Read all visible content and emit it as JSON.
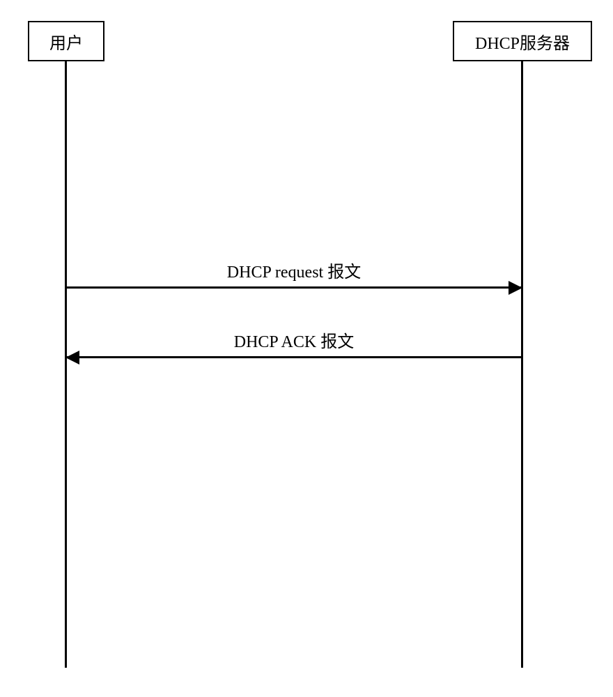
{
  "participants": {
    "left": "用户",
    "right": "DHCP服务器"
  },
  "messages": [
    {
      "label": "DHCP request 报文",
      "direction": "right"
    },
    {
      "label": "DHCP ACK 报文",
      "direction": "left"
    }
  ],
  "chart_data": {
    "type": "sequence-diagram",
    "participants": [
      "用户",
      "DHCP服务器"
    ],
    "messages": [
      {
        "from": "用户",
        "to": "DHCP服务器",
        "label": "DHCP request 报文"
      },
      {
        "from": "DHCP服务器",
        "to": "用户",
        "label": "DHCP ACK 报文"
      }
    ]
  }
}
